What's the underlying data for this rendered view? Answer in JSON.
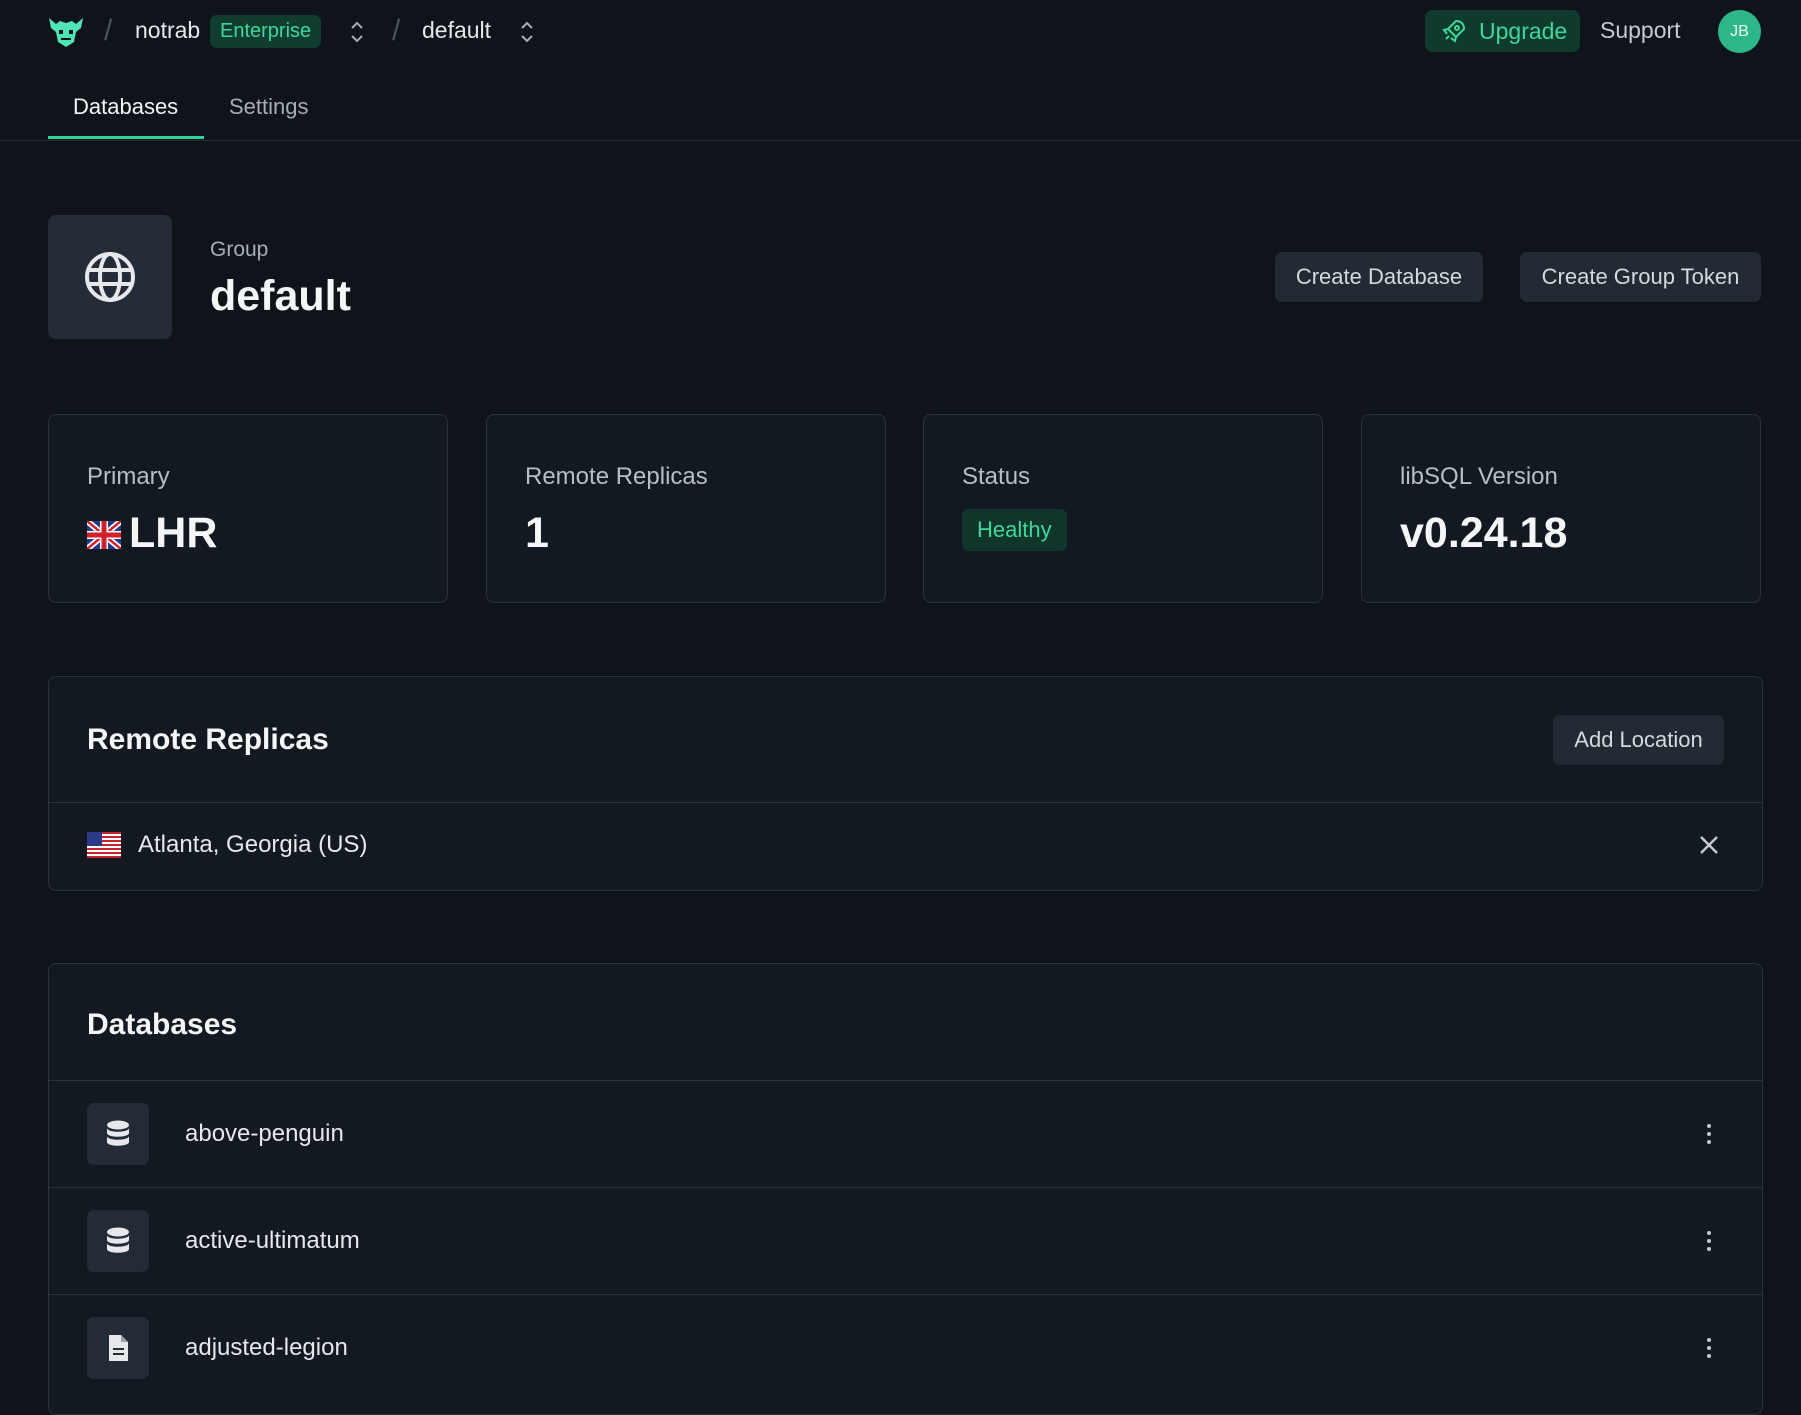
{
  "topbar": {
    "org_name": "notrab",
    "plan_badge": "Enterprise",
    "group_name": "default",
    "upgrade_label": "Upgrade",
    "support_label": "Support",
    "avatar_initials": "JB"
  },
  "tabs": [
    {
      "label": "Databases",
      "active": true
    },
    {
      "label": "Settings",
      "active": false
    }
  ],
  "group": {
    "label": "Group",
    "name": "default",
    "create_database_label": "Create Database",
    "create_token_label": "Create Group Token"
  },
  "stats": {
    "primary": {
      "label": "Primary",
      "value": "LHR",
      "flag": "uk-flag-icon"
    },
    "replicas": {
      "label": "Remote Replicas",
      "value": "1"
    },
    "status": {
      "label": "Status",
      "value": "Healthy"
    },
    "version": {
      "label": "libSQL Version",
      "value": "v0.24.18"
    }
  },
  "remote_replicas": {
    "title": "Remote Replicas",
    "add_label": "Add Location",
    "items": [
      {
        "label": "Atlanta, Georgia (US)",
        "flag": "us-flag-icon"
      }
    ]
  },
  "databases": {
    "title": "Databases",
    "items": [
      {
        "name": "above-penguin",
        "icon": "database-icon"
      },
      {
        "name": "active-ultimatum",
        "icon": "database-icon"
      },
      {
        "name": "adjusted-legion",
        "icon": "file-icon"
      }
    ]
  },
  "colors": {
    "background": "#0f141b",
    "accent": "#3fd79a",
    "panel": "#131920",
    "border": "#2a323c"
  }
}
